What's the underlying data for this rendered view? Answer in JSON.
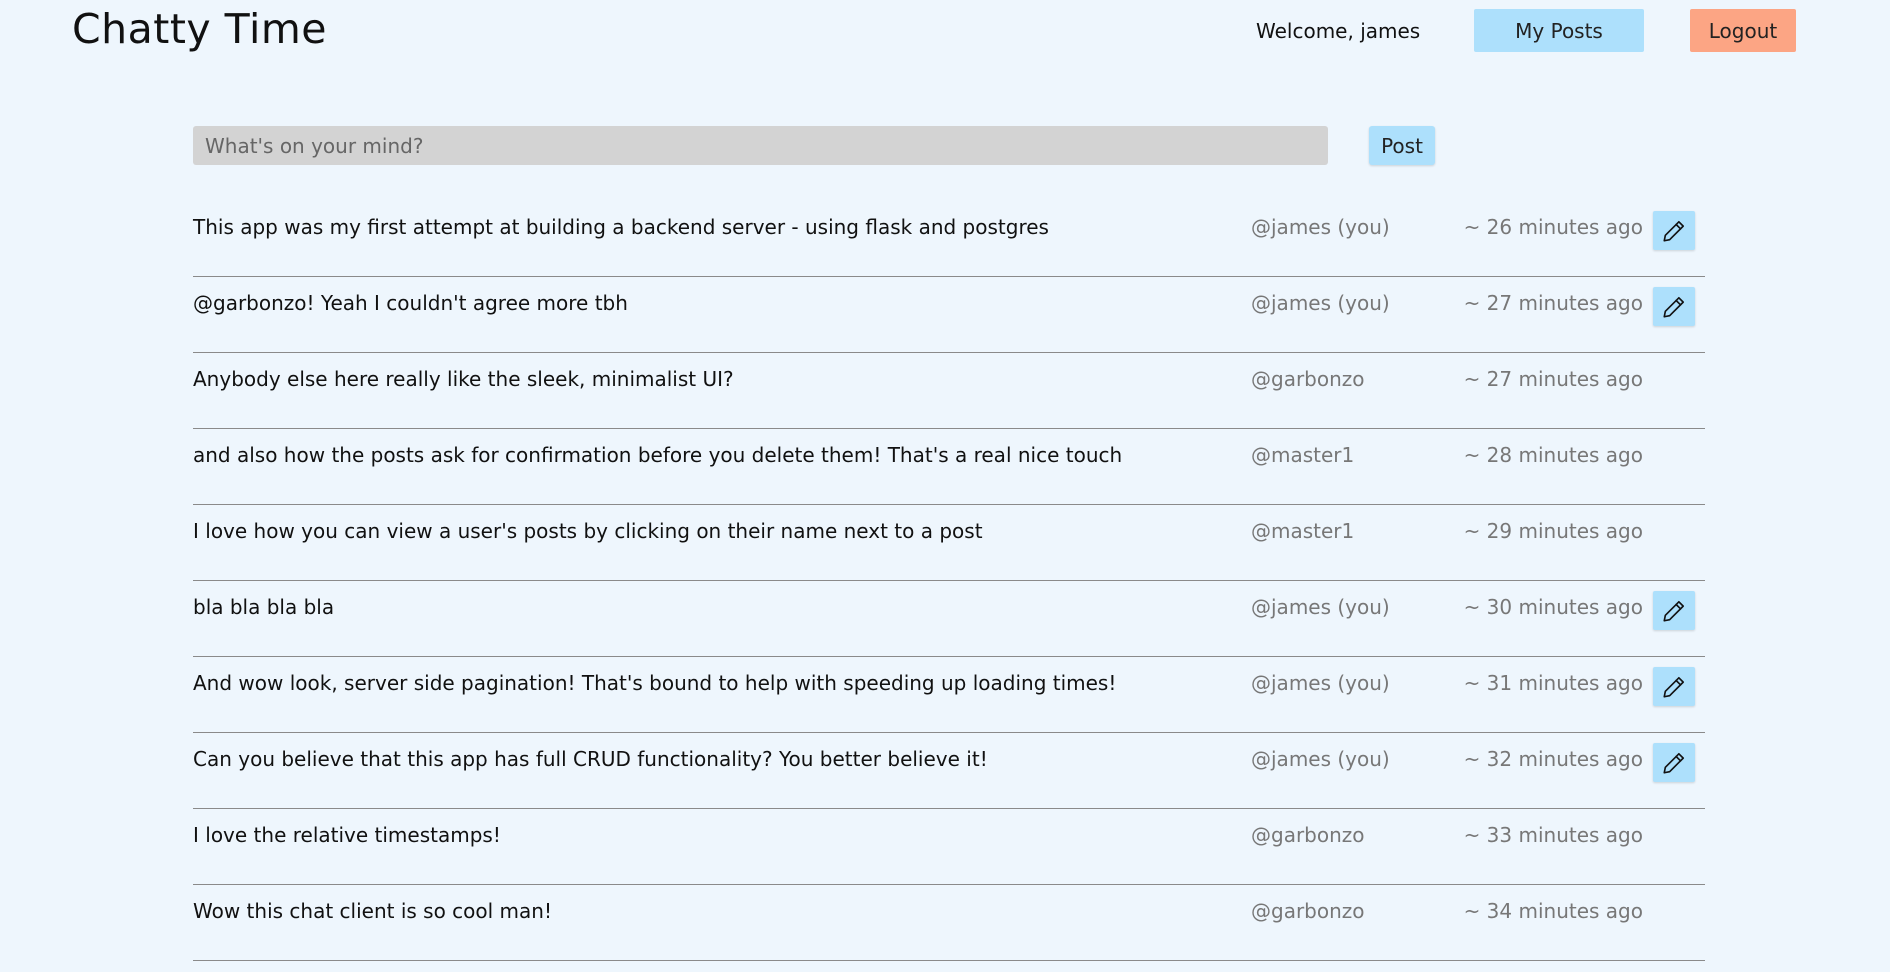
{
  "header": {
    "title": "Chatty Time",
    "welcome": "Welcome, james",
    "my_posts_label": "My Posts",
    "logout_label": "Logout"
  },
  "composer": {
    "placeholder": "What's on your mind?",
    "value": "",
    "post_label": "Post"
  },
  "posts": [
    {
      "text": "This app was my first attempt at building a backend server - using flask and postgres",
      "author": "@james (you)",
      "time": "~ 26 minutes ago",
      "editable": true
    },
    {
      "text": "@garbonzo! Yeah I couldn't agree more tbh",
      "author": "@james (you)",
      "time": "~ 27 minutes ago",
      "editable": true
    },
    {
      "text": "Anybody else here really like the sleek, minimalist UI?",
      "author": "@garbonzo",
      "time": "~ 27 minutes ago",
      "editable": false
    },
    {
      "text": "and also how the posts ask for confirmation before you delete them! That's a real nice touch",
      "author": "@master1",
      "time": "~ 28 minutes ago",
      "editable": false
    },
    {
      "text": "I love how you can view a user's posts by clicking on their name next to a post",
      "author": "@master1",
      "time": "~ 29 minutes ago",
      "editable": false
    },
    {
      "text": "bla bla bla bla",
      "author": "@james (you)",
      "time": "~ 30 minutes ago",
      "editable": true
    },
    {
      "text": "And wow look, server side pagination! That's bound to help with speeding up loading times!",
      "author": "@james (you)",
      "time": "~ 31 minutes ago",
      "editable": true
    },
    {
      "text": "Can you believe that this app has full CRUD functionality? You better believe it!",
      "author": "@james (you)",
      "time": "~ 32 minutes ago",
      "editable": true
    },
    {
      "text": "I love the relative timestamps!",
      "author": "@garbonzo",
      "time": "~ 33 minutes ago",
      "editable": false
    },
    {
      "text": "Wow this chat client is so cool man!",
      "author": "@garbonzo",
      "time": "~ 34 minutes ago",
      "editable": false
    }
  ],
  "icons": {
    "edit": "pencil-icon"
  },
  "colors": {
    "background": "#eef6fd",
    "accent": "#ade0fc",
    "logout": "#fca584",
    "input": "#d3d3d3",
    "muted_text": "#777777"
  }
}
